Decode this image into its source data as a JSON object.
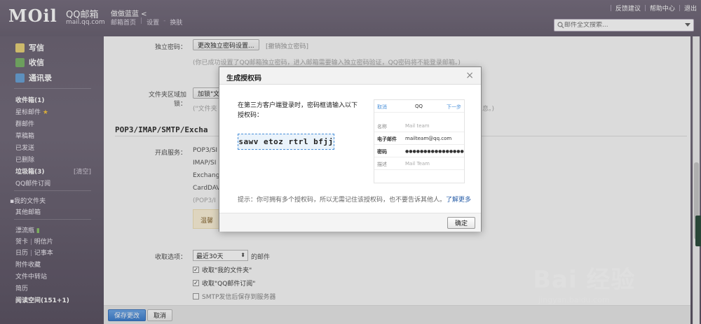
{
  "header": {
    "logo": "MOil",
    "title": "QQ邮箱",
    "domain": "mail.qq.com",
    "user": "做做蓝蓝 <",
    "links": [
      "邮箱首页",
      "设置",
      "换肤"
    ],
    "right_links": [
      "反馈建议",
      "帮助中心",
      "退出"
    ],
    "search_placeholder": "邮件全文搜索..."
  },
  "sidebar": {
    "actions": [
      {
        "label": "写信",
        "icon": "pen-icon"
      },
      {
        "label": "收信",
        "icon": "inbox-icon"
      },
      {
        "label": "通讯录",
        "icon": "contacts-icon"
      }
    ],
    "folders": [
      "收件箱(1)",
      "星标邮件",
      "群邮件",
      "草稿箱",
      "已发送",
      "已删除",
      "垃圾箱(3)",
      "QQ邮件订阅"
    ],
    "trash_clear": "[清空]",
    "my_folders": "我的文件夹",
    "other_mailbox": "其他邮箱",
    "apps": [
      "漂流瓶",
      "贺卡",
      "明信片",
      "日历",
      "记事本",
      "附件收藏",
      "文件中转站",
      "简历",
      "阅读空间(151+1)"
    ]
  },
  "settings": {
    "independent_pw_label": "独立密码：",
    "independent_pw_button": "更改独立密码设置...",
    "independent_pw_cancel": "[撤销独立密码]",
    "independent_pw_note": "(你已成功设置了QQ邮箱独立密码，进入邮箱需要输入独立密码验证，QQ密码将不能登录邮箱。)",
    "folder_lock_label": "文件夹区域加锁：",
    "folder_lock_button": "加锁\"文",
    "folder_lock_note": "(\"文件夹",
    "folder_lock_note_end": "息。)",
    "section_title": "POP3/IMAP/SMTP/Excha",
    "service_label": "开启服务：",
    "services": [
      "POP3/SI",
      "IMAP/SI",
      "Exchang",
      "CardDAV"
    ],
    "service_note": "(POP3/I",
    "notice": "温馨",
    "receive_label": "收取选项：",
    "receive_select": "最近30天",
    "receive_suffix": "的邮件",
    "checkboxes": [
      {
        "label": "收取\"我的文件夹\"",
        "checked": true
      },
      {
        "label": "收取\"QQ邮件订阅\"",
        "checked": true
      },
      {
        "label": "SMTP发信后保存到服务器",
        "checked": false
      }
    ],
    "save_button": "保存更改",
    "cancel_button": "取消"
  },
  "dialog": {
    "title": "生成授权码",
    "message_line1": "在第三方客户端登录时，密码框请输入以下",
    "message_line2": "授权码：",
    "code": "sawv etoz rtrl bfjj",
    "phone": {
      "cancel": "取消",
      "title": "QQ",
      "next": "下一步",
      "rows": [
        {
          "key": "名称",
          "value": "Mail team"
        },
        {
          "key": "电子邮件",
          "value": "mailteam@qq.com"
        },
        {
          "key": "密码",
          "value": "●●●●●●●●●●●●●●●●"
        },
        {
          "key": "描述",
          "value": "Mail Team"
        }
      ]
    },
    "tip": "提示：你可拥有多个授权码，所以无需记住该授权码，也不要告诉其他人。",
    "tip_link": "了解更多",
    "ok_button": "确定"
  },
  "watermark": {
    "brand": "Bai 经验",
    "url": "jingyan.baidu.com"
  }
}
